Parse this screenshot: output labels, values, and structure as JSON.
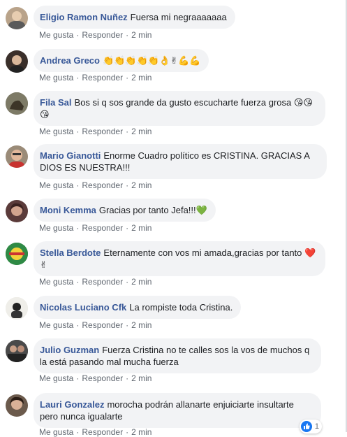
{
  "comments": [
    {
      "author": "Eligio Ramon Nuñez",
      "text": "Fuersa mi negraaaaaaa",
      "like": "Me gusta",
      "reply": "Responder",
      "time": "2 min"
    },
    {
      "author": "Andrea Greco",
      "text": "👏👏👏👏👏👌✌💪💪",
      "like": "Me gusta",
      "reply": "Responder",
      "time": "2 min"
    },
    {
      "author": "Fila Sal",
      "text": "Bos si q sos grande da gusto escucharte fuerza grosa 😘😘😘",
      "like": "Me gusta",
      "reply": "Responder",
      "time": "2 min"
    },
    {
      "author": "Mario Gianotti",
      "text": "Enorme Cuadro político es CRISTINA. GRACIAS A DIOS ES NUESTRA!!!",
      "like": "Me gusta",
      "reply": "Responder",
      "time": "2 min"
    },
    {
      "author": "Moni Kemma",
      "text": "Gracias por tanto Jefa!!!💚",
      "like": "Me gusta",
      "reply": "Responder",
      "time": "2 min"
    },
    {
      "author": "Stella Berdote",
      "text": "Eternamente con vos mi amada,gracias por tanto ❤️✌",
      "like": "Me gusta",
      "reply": "Responder",
      "time": "2 min"
    },
    {
      "author": "Nicolas Luciano Cfk",
      "text": "La rompiste toda Cristina.",
      "like": "Me gusta",
      "reply": "Responder",
      "time": "2 min"
    },
    {
      "author": "Julio Guzman",
      "text": "Fuerza Cristina no te calles sos la vos de muchos q la está pasando mal mucha fuerza",
      "like": "Me gusta",
      "reply": "Responder",
      "time": "2 min"
    },
    {
      "author": "Lauri Gonzalez",
      "text": "morocha podrán allanarte enjuiciarte insultarte pero nunca igualarte",
      "like": "Me gusta",
      "reply": "Responder",
      "time": "2 min"
    }
  ],
  "reaction": {
    "count": "1",
    "icon": "like-icon",
    "color": "#1877f2"
  },
  "colors": {
    "author": "#385898",
    "bubble": "#f2f3f5",
    "meta": "#606770"
  }
}
